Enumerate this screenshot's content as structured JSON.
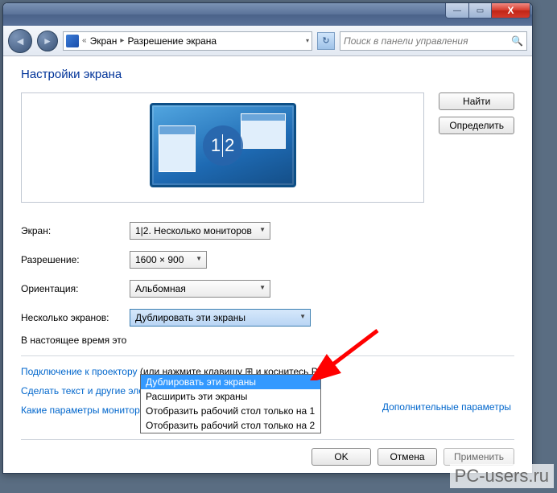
{
  "titlebar": {
    "minimize_glyph": "—",
    "maximize_glyph": "▭",
    "close_glyph": "X"
  },
  "navbar": {
    "back_glyph": "◄",
    "forward_glyph": "►",
    "breadcrumb_sep": "«",
    "crumb1": "Экран",
    "crumb_arrow": "▸",
    "crumb2": "Разрешение экрана",
    "refresh_glyph": "↻",
    "search_placeholder": "Поиск в панели управления",
    "search_glyph": "🔍"
  },
  "heading": "Настройки экрана",
  "monitor_badge": {
    "one": "1",
    "two": "2"
  },
  "side_buttons": {
    "find": "Найти",
    "identify": "Определить"
  },
  "form": {
    "screen_label": "Экран:",
    "screen_value": "1|2. Несколько мониторов",
    "resolution_label": "Разрешение:",
    "resolution_value": "1600 × 900",
    "orientation_label": "Ориентация:",
    "orientation_value": "Альбомная",
    "multi_label": "Несколько экранов:",
    "multi_value": "Дублировать эти экраны"
  },
  "dropdown_options": {
    "o0": "Дублировать эти экраны",
    "o1": "Расширить эти экраны",
    "o2": "Отобразить рабочий стол только на 1",
    "o3": "Отобразить рабочий стол только на 2"
  },
  "below": {
    "current_text": "В настоящее время это",
    "advanced_link": "Дополнительные параметры"
  },
  "links": {
    "projector_link": "Подключение к проектору",
    "projector_aside": "(или нажмите клавишу ⊞ и коснитесь P)",
    "text_size": "Сделать текст и другие элементы больше или меньше",
    "which_params": "Какие параметры монитора следует выбрать?"
  },
  "footer": {
    "ok": "OK",
    "cancel": "Отмена",
    "apply": "Применить"
  },
  "watermark": "PC-users.ru"
}
